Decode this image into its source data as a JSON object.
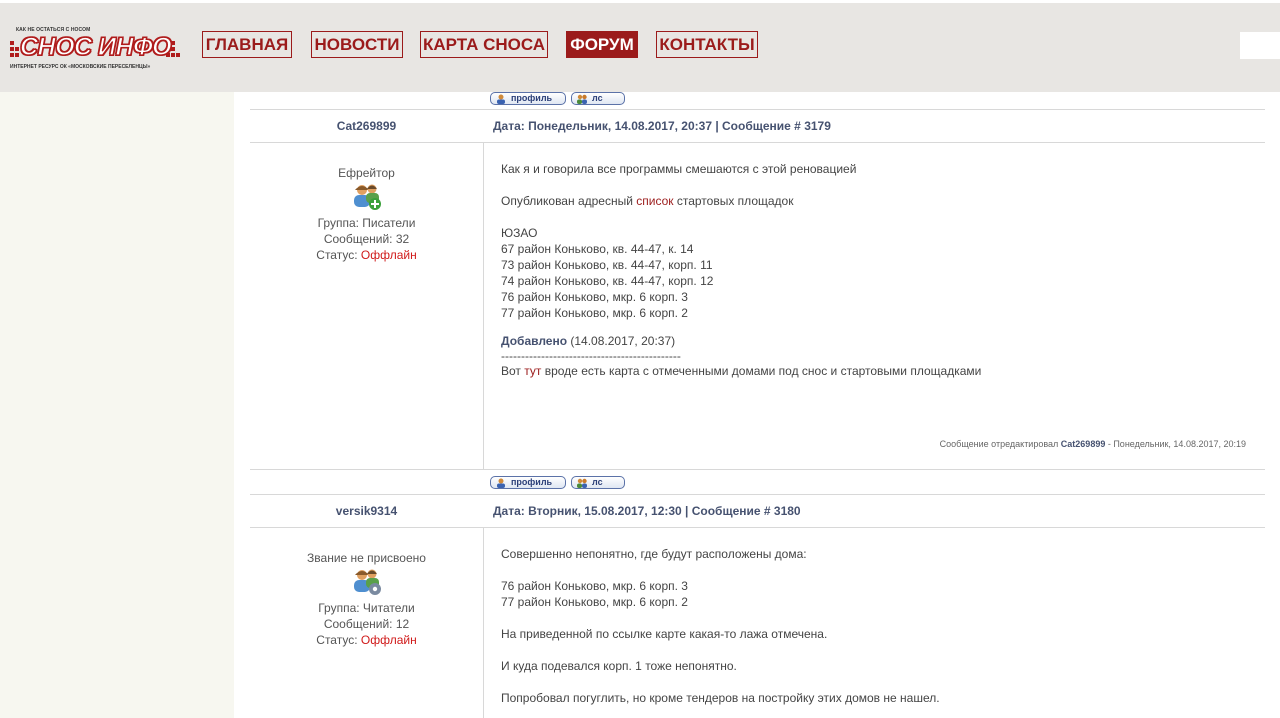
{
  "header": {
    "logo": {
      "tagline_top": "КАК НЕ ОСТАТЬСЯ С НОСОМ",
      "brand": "СНОС ИНФО",
      "tagline_bottom": "ИНТЕРНЕТ РЕСУРС ОК «МОСКОВСКИЕ ПЕРЕСЕЛЕНЦЫ»"
    },
    "nav": [
      {
        "label": "ГЛАВНАЯ",
        "active": false
      },
      {
        "label": "НОВОСТИ",
        "active": false
      },
      {
        "label": "КАРТА СНОСА",
        "active": false
      },
      {
        "label": "ФОРУМ",
        "active": true
      },
      {
        "label": "КОНТАКТЫ",
        "active": false
      }
    ]
  },
  "buttons": {
    "profile": "профиль",
    "pm": "лс"
  },
  "posts": [
    {
      "author": "Cat269899",
      "date_line": "Дата: Понедельник, 14.08.2017, 20:37 | Сообщение # 3179",
      "rank": "Ефрейтор",
      "group": "Группа: Писатели",
      "messages": "Сообщений: 32",
      "status_label": "Статус: ",
      "status_value": "Оффлайн",
      "body": {
        "line1": "Как я и говорила все программы смешаются с этой реновацией",
        "line2_pre": "Опубликован адресный ",
        "line2_link": "список",
        "line2_post": " стартовых площадок",
        "region": "ЮЗАО",
        "addresses": [
          "67 район Коньково, кв. 44-47, к. 14",
          "73 район Коньково, кв. 44-47, корп. 11",
          "74 район Коньково, кв. 44-47, корп. 12",
          "76 район Коньково, мкр. 6 корп. 3",
          "77 район Коньково, мкр. 6 корп. 2"
        ],
        "added_label": "Добавлено",
        "added_date": " (14.08.2017, 20:37)",
        "divider": "---------------------------------------------",
        "last_pre": "Вот ",
        "last_link": "тут",
        "last_post": " вроде есть карта с отмеченными домами под снос и стартовыми площадками"
      },
      "edit_note_pre": "Сообщение отредактировал ",
      "edit_note_author": "Cat269899",
      "edit_note_post": " - Понедельник, 14.08.2017, 20:19"
    },
    {
      "author": "versik9314",
      "date_line": "Дата: Вторник, 15.08.2017, 12:30 | Сообщение # 3180",
      "rank": "Звание не присвоено",
      "group": "Группа: Читатели",
      "messages": "Сообщений: 12",
      "status_label": "Статус: ",
      "status_value": "Оффлайн",
      "body": {
        "line1": "Совершенно непонятно, где будут расположены дома:",
        "addresses": [
          "76 район Коньково, мкр. 6 корп. 3",
          "77 район Коньково, мкр. 6 корп. 2"
        ],
        "line3": "На приведенной по ссылке карте какая-то лажа отмечена.",
        "line4": "И куда подевался корп. 1 тоже непонятно.",
        "line5": "Попробовал погуглить, но кроме тендеров на постройку этих домов не нашел."
      }
    }
  ]
}
